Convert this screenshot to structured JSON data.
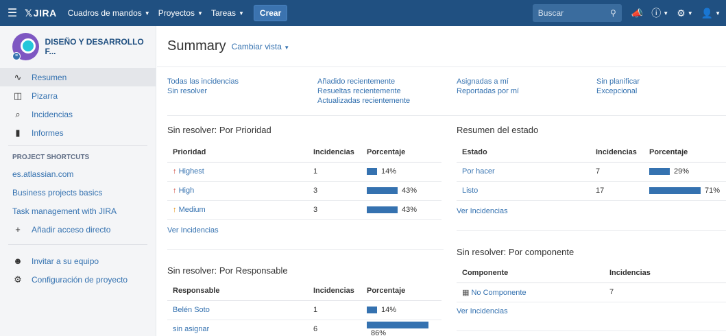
{
  "topbar": {
    "menu_icon": "hamburger-icon",
    "logo_text": "JIRA",
    "nav": [
      {
        "label": "Cuadros de mandos"
      },
      {
        "label": "Proyectos"
      },
      {
        "label": "Tareas"
      }
    ],
    "create_label": "Crear",
    "search_placeholder": "Buscar"
  },
  "sidebar": {
    "project_name": "DISEÑO Y DESARROLLO F...",
    "nav": [
      {
        "label": "Resumen",
        "icon": "pulse-icon",
        "active": true
      },
      {
        "label": "Pizarra",
        "icon": "board-icon"
      },
      {
        "label": "Incidencias",
        "icon": "search-list-icon"
      },
      {
        "label": "Informes",
        "icon": "bar-chart-icon"
      }
    ],
    "shortcuts_heading": "PROJECT SHORTCUTS",
    "shortcuts": [
      {
        "label": "es.atlassian.com"
      },
      {
        "label": "Business projects basics"
      },
      {
        "label": "Task management with JIRA"
      }
    ],
    "add_shortcut": "Añadir acceso directo",
    "invite": "Invitar a su equipo",
    "settings": "Configuración de proyecto"
  },
  "main": {
    "title": "Summary",
    "change_view": "Cambiar vista",
    "filters": [
      [
        "Todas las incidencias",
        "Sin resolver"
      ],
      [
        "Añadido recientemente",
        "Resueltas recientemente",
        "Actualizadas recientemente"
      ],
      [
        "Asignadas a mí",
        "Reportadas por mí"
      ],
      [
        "Sin planificar",
        "Excepcional"
      ]
    ],
    "priority": {
      "title": "Sin resolver: Por Prioridad",
      "headers": [
        "Prioridad",
        "Incidencias",
        "Porcentaje"
      ],
      "rows": [
        {
          "name": "Highest",
          "count": "1",
          "pct": "14%",
          "frac": 0.14
        },
        {
          "name": "High",
          "count": "3",
          "pct": "43%",
          "frac": 0.43
        },
        {
          "name": "Medium",
          "count": "3",
          "pct": "43%",
          "frac": 0.43
        }
      ],
      "link": "Ver Incidencias"
    },
    "status": {
      "title": "Resumen del estado",
      "headers": [
        "Estado",
        "Incidencias",
        "Porcentaje"
      ],
      "rows": [
        {
          "name": "Por hacer",
          "count": "7",
          "pct": "29%",
          "frac": 0.29
        },
        {
          "name": "Listo",
          "count": "17",
          "pct": "71%",
          "frac": 0.71
        }
      ],
      "link": "Ver Incidencias"
    },
    "assignee": {
      "title": "Sin resolver: Por Responsable",
      "headers": [
        "Responsable",
        "Incidencias",
        "Porcentaje"
      ],
      "rows": [
        {
          "name": "Belén Soto",
          "count": "1",
          "pct": "14%",
          "frac": 0.14
        },
        {
          "name": "sin asignar",
          "count": "6",
          "pct": "86%",
          "frac": 0.86
        }
      ]
    },
    "component": {
      "title": "Sin resolver: Por componente",
      "headers": [
        "Componente",
        "Incidencias"
      ],
      "rows": [
        {
          "name": "No Componente",
          "count": "7"
        }
      ],
      "link": "Ver Incidencias"
    }
  }
}
